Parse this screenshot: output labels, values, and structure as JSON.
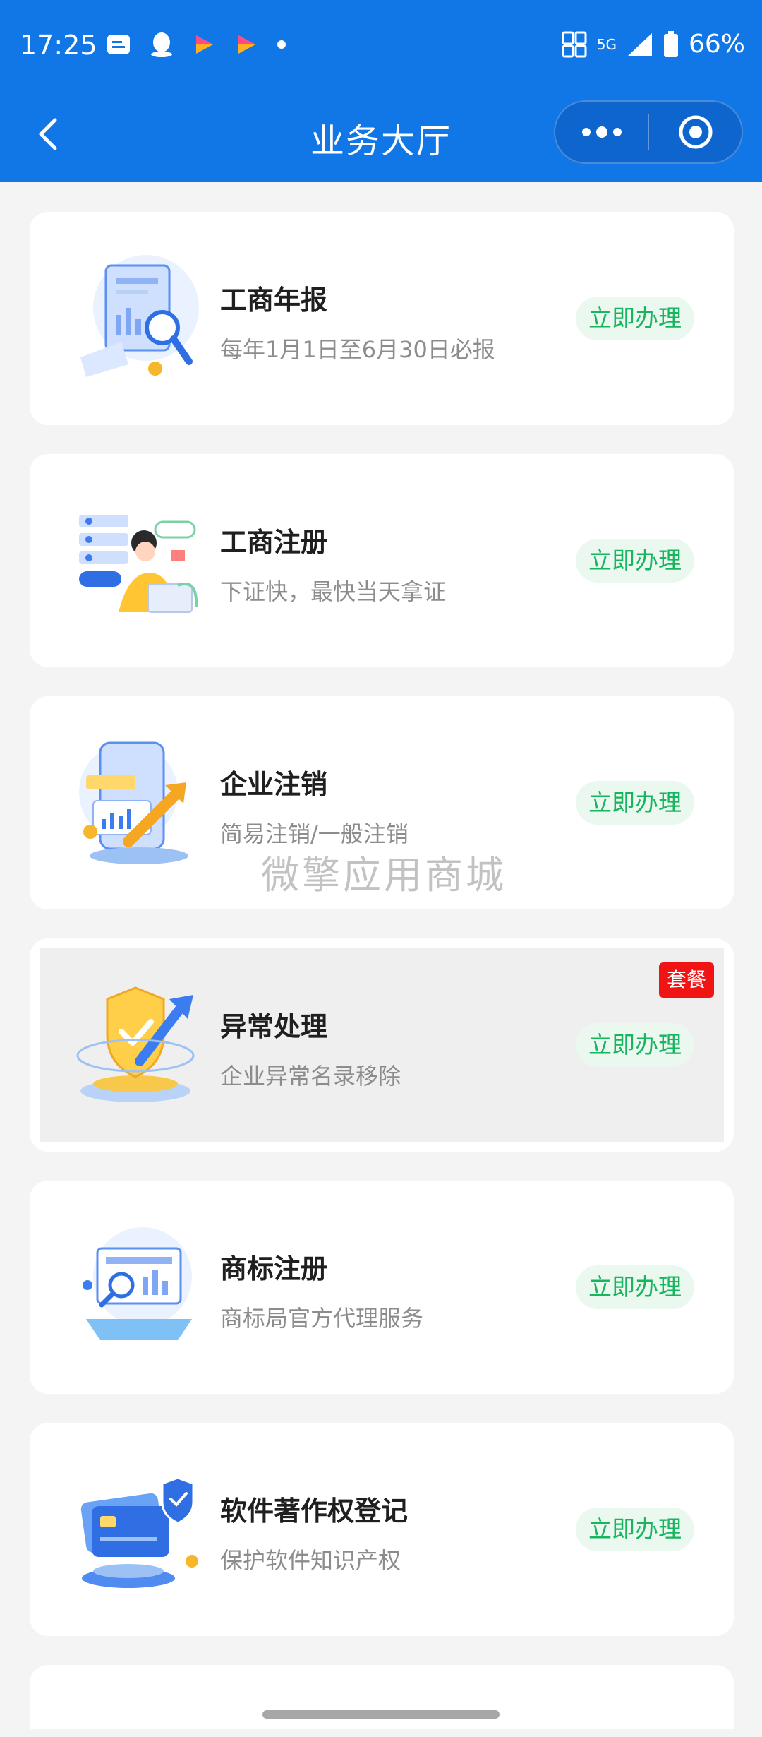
{
  "status_bar": {
    "time": "17:25",
    "network": "5G",
    "battery": "66%"
  },
  "navbar": {
    "title": "业务大厅",
    "back_icon": "chevron-left-icon",
    "more_icon": "more-dots-icon",
    "close_icon": "target-circle-icon"
  },
  "services": [
    {
      "title": "工商年报",
      "desc": "每年1月1日至6月30日必报",
      "button": "立即办理",
      "icon": "report-magnifier-icon",
      "badge": ""
    },
    {
      "title": "工商注册",
      "desc": "下证快，最快当天拿证",
      "button": "立即办理",
      "icon": "person-laptop-icon",
      "badge": ""
    },
    {
      "title": "企业注销",
      "desc": "简易注销/一般注销",
      "button": "立即办理",
      "icon": "phone-growth-icon",
      "badge": ""
    },
    {
      "title": "异常处理",
      "desc": "企业异常名录移除",
      "button": "立即办理",
      "icon": "shield-arrow-icon",
      "badge": "套餐"
    },
    {
      "title": "商标注册",
      "desc": "商标局官方代理服务",
      "button": "立即办理",
      "icon": "laptop-chart-icon",
      "badge": ""
    },
    {
      "title": "软件著作权登记",
      "desc": "保护软件知识产权",
      "button": "立即办理",
      "icon": "cards-shield-icon",
      "badge": ""
    }
  ],
  "watermark": "微擎应用商城",
  "colors": {
    "header_blue": "#1177e6",
    "action_green": "#17b55e",
    "badge_red": "#f01414"
  }
}
